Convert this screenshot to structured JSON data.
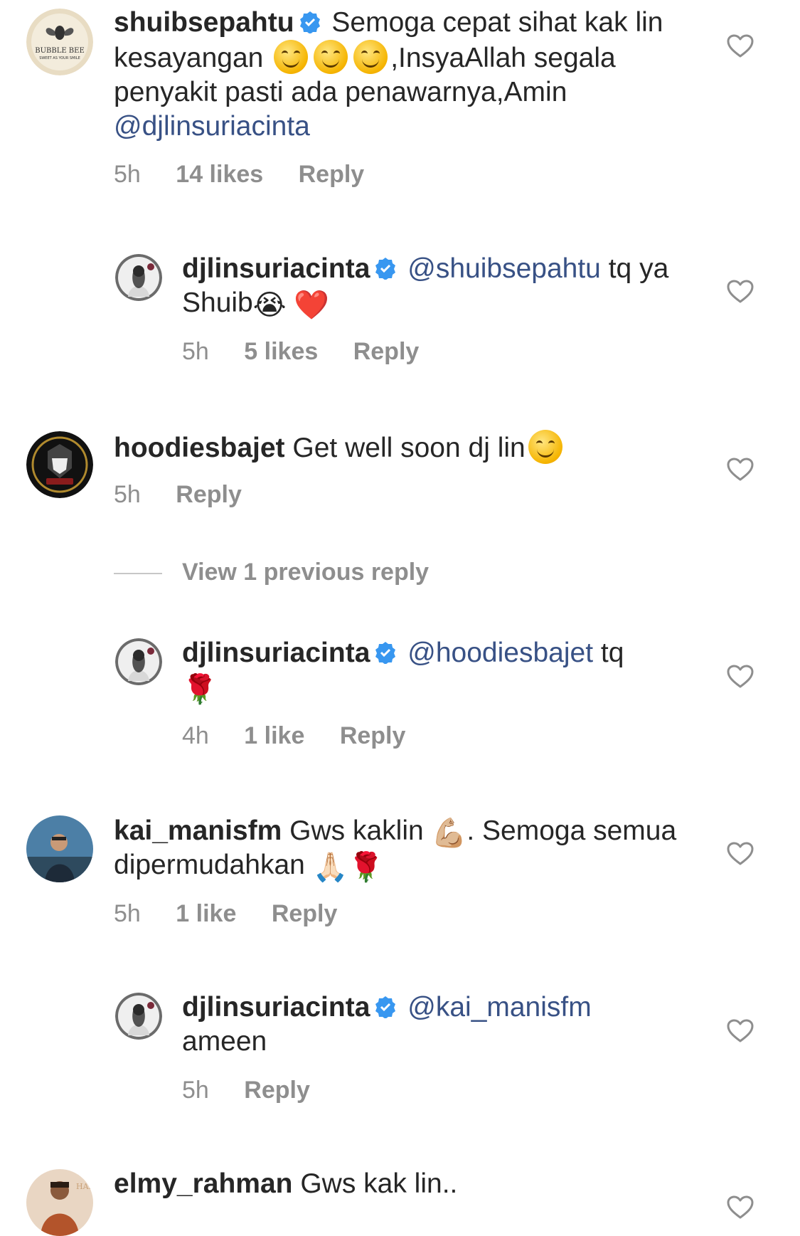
{
  "comments": [
    {
      "username": "shuibsepahtu",
      "avatar_icon": "bubble-bee-logo-avatar",
      "text_1": "Semoga cepat sihat kak lin kesayangan",
      "emoji_1": "😊",
      "emoji_2": "😊",
      "emoji_3": "😊",
      "text_2": ",InsyaAllah segala penyakit pasti ada penawarnya,Amin",
      "mention": "@djlinsuriacinta",
      "time": "5h",
      "likes": "14 likes",
      "reply": "Reply"
    },
    {
      "username": "djlinsuriacinta",
      "avatar_icon": "woman-with-roses-avatar",
      "mention": "@shuibsepahtu",
      "text_1": "tq ya Shuib",
      "emoji_1": "😭",
      "emoji_2": "❤️",
      "time": "5h",
      "likes": "5 likes",
      "reply": "Reply"
    },
    {
      "username": "hoodiesbajet",
      "avatar_icon": "masked-hoodie-logo-avatar",
      "text_1": "Get well soon dj lin",
      "emoji_1": "😊",
      "time": "5h",
      "reply": "Reply"
    },
    {
      "username": "djlinsuriacinta",
      "avatar_icon": "woman-with-roses-avatar",
      "mention": "@hoodiesbajet",
      "text_1": "tq",
      "emoji_1": "🌹",
      "time": "4h",
      "likes": "1 like",
      "reply": "Reply"
    },
    {
      "username": "kai_manisfm",
      "avatar_icon": "man-outdoors-avatar",
      "text_1": "Gws kaklin",
      "emoji_1": "💪🏼",
      "text_2": ". Semoga semua dipermudahkan",
      "emoji_2": "🙏🏻",
      "emoji_3": "🌹",
      "time": "5h",
      "likes": "1 like",
      "reply": "Reply"
    },
    {
      "username": "djlinsuriacinta",
      "avatar_icon": "woman-with-roses-avatar",
      "mention": "@kai_manisfm",
      "text_1": "ameen",
      "time": "5h",
      "reply": "Reply"
    },
    {
      "username": "elmy_rahman",
      "avatar_icon": "man-orange-background-avatar",
      "text_1": "Gws kak lin.."
    }
  ],
  "view_previous_reply": "View 1 previous reply",
  "colors": {
    "text": "#262626",
    "secondary": "#8e8e8e",
    "mention": "#385185",
    "verified": "#3897f0"
  },
  "icons": {
    "like": "heart-outline-icon",
    "verified": "verified-badge-icon"
  }
}
